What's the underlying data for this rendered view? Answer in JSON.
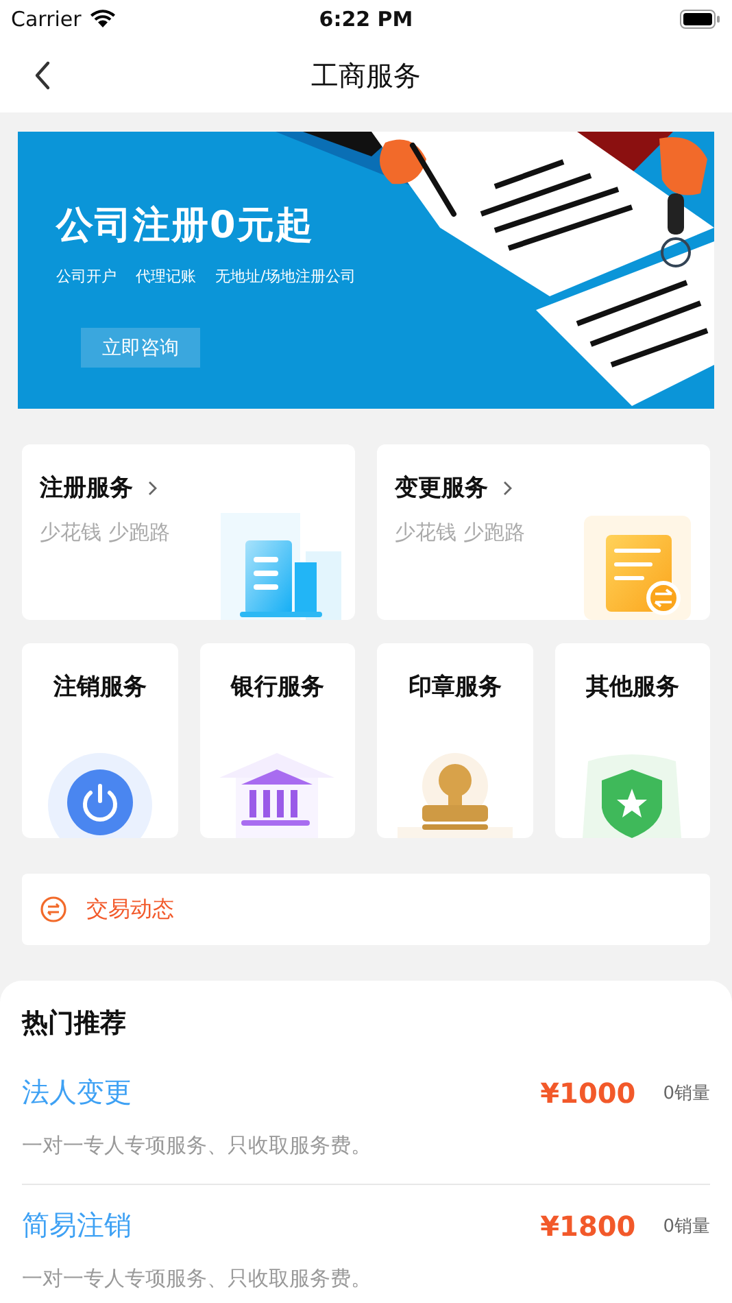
{
  "status_bar": {
    "carrier": "Carrier",
    "time": "6:22 PM"
  },
  "nav": {
    "title": "工商服务"
  },
  "banner": {
    "headline": "公司注册0元起",
    "tags": [
      "公司开户",
      "代理记账",
      "无地址/场地注册公司"
    ],
    "button": "立即咨询"
  },
  "large_services": [
    {
      "title": "注册服务",
      "subtitle": "少花钱 少跑路",
      "kind": "building"
    },
    {
      "title": "变更服务",
      "subtitle": "少花钱 少跑路",
      "kind": "document"
    }
  ],
  "small_services": [
    {
      "title": "注销服务",
      "kind": "power"
    },
    {
      "title": "银行服务",
      "kind": "bank"
    },
    {
      "title": "印章服务",
      "kind": "stamp"
    },
    {
      "title": "其他服务",
      "kind": "shield"
    }
  ],
  "trade_news": {
    "label": "交易动态"
  },
  "hot": {
    "title": "热门推荐",
    "items": [
      {
        "name": "法人变更",
        "price": "¥1000",
        "sales": "0销量",
        "description": "一对一专人专项服务、只收取服务费。"
      },
      {
        "name": "简易注销",
        "price": "¥1800",
        "sales": "0销量",
        "description": "一对一专人专项服务、只收取服务费。"
      }
    ]
  }
}
